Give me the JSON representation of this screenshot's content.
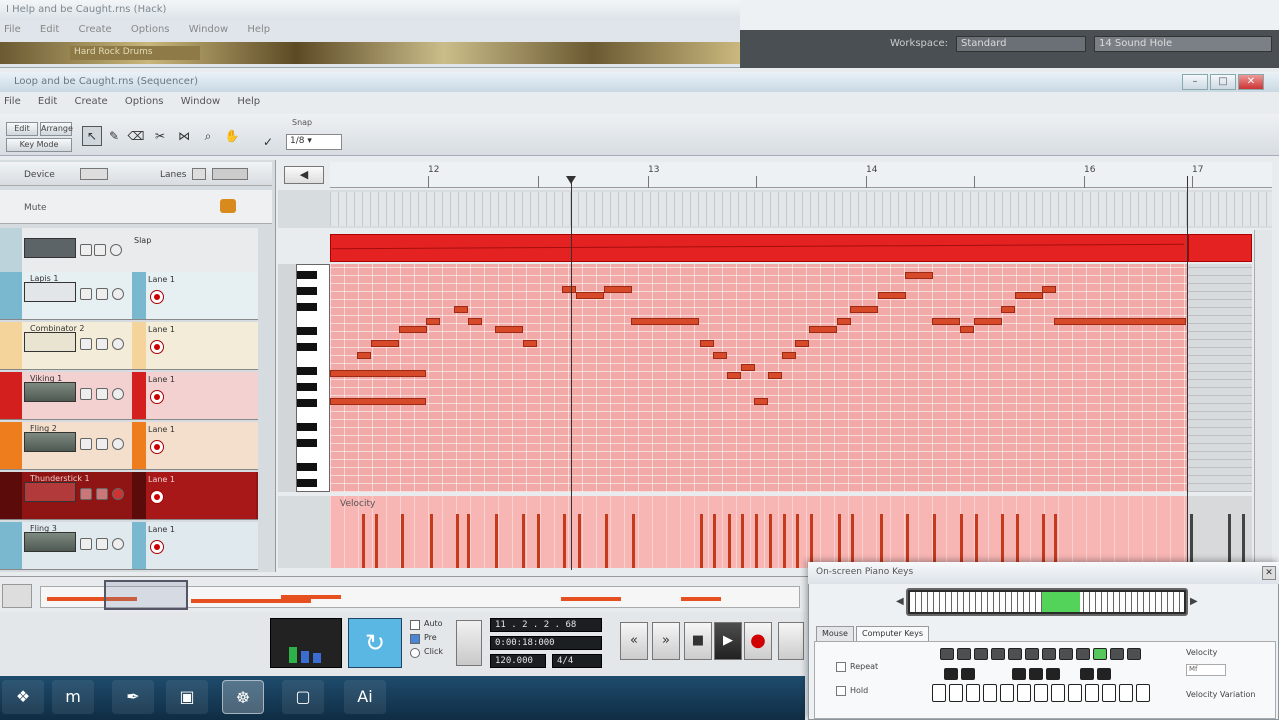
{
  "background_window": {
    "title": "I Help and be Caught.rns (Hack)",
    "menu": [
      "File",
      "Edit",
      "Create",
      "Options",
      "Window",
      "Help"
    ],
    "strip_label": "Hard Rock Drums",
    "workspace_label": "Workspace:",
    "workspace_value": "Standard",
    "workspace_right": "14 Sound Hole"
  },
  "main_window": {
    "title": "Loop and be Caught.rns (Sequencer)",
    "menu": [
      "File",
      "Edit",
      "Create",
      "Options",
      "Window",
      "Help"
    ]
  },
  "toolbar": {
    "mode_edit": "Edit",
    "mode_arrange": "Arrange",
    "mode_key": "Key Mode",
    "snap_label": "Snap",
    "snap_value": "1/8"
  },
  "tracklist": {
    "device_label": "Device",
    "lanes_label": "Lanes",
    "mute_label": "Mute",
    "tracks": [
      {
        "name": "Slap",
        "lane": ""
      },
      {
        "name": "Lapis 1",
        "lane": "Lane 1"
      },
      {
        "name": "Combinator 2",
        "lane": "Lane 1"
      },
      {
        "name": "Viking 1",
        "lane": "Lane 1"
      },
      {
        "name": "Fling 2",
        "lane": "Lane 1"
      },
      {
        "name": "Thunderstick 1",
        "lane": "Lane 1"
      },
      {
        "name": "Fling 3",
        "lane": "Lane 1"
      }
    ]
  },
  "ruler": {
    "bars": [
      "12",
      "",
      "13",
      "",
      "14",
      "",
      "16",
      "17"
    ]
  },
  "editor": {
    "velocity_label": "Velocity"
  },
  "notes": [
    [
      330,
      96,
      370
    ],
    [
      330,
      96,
      398
    ],
    [
      357,
      14,
      352
    ],
    [
      371,
      28,
      340
    ],
    [
      399,
      28,
      326
    ],
    [
      426,
      14,
      318
    ],
    [
      454,
      14,
      306
    ],
    [
      468,
      14,
      318
    ],
    [
      495,
      28,
      326
    ],
    [
      523,
      14,
      340
    ],
    [
      562,
      14,
      286
    ],
    [
      576,
      28,
      292
    ],
    [
      604,
      28,
      286
    ],
    [
      631,
      68,
      318
    ],
    [
      700,
      14,
      340
    ],
    [
      713,
      14,
      352
    ],
    [
      727,
      14,
      372
    ],
    [
      741,
      14,
      364
    ],
    [
      754,
      14,
      398
    ],
    [
      768,
      14,
      372
    ],
    [
      782,
      14,
      352
    ],
    [
      795,
      14,
      340
    ],
    [
      809,
      28,
      326
    ],
    [
      837,
      14,
      318
    ],
    [
      850,
      28,
      306
    ],
    [
      878,
      28,
      292
    ],
    [
      905,
      28,
      272
    ],
    [
      932,
      28,
      318
    ],
    [
      960,
      14,
      326
    ],
    [
      974,
      28,
      318
    ],
    [
      1001,
      14,
      306
    ],
    [
      1015,
      28,
      292
    ],
    [
      1042,
      14,
      286
    ],
    [
      1054,
      132,
      318
    ]
  ],
  "velocities": [
    362,
    375,
    401,
    430,
    456,
    467,
    495,
    522,
    537,
    563,
    578,
    605,
    632,
    700,
    713,
    728,
    741,
    755,
    769,
    783,
    796,
    810,
    838,
    851,
    880,
    906,
    933,
    960,
    975,
    1001,
    1016,
    1042,
    1054
  ],
  "transport": {
    "lcd_position": "11 . 2 . 2 . 68",
    "lcd_time": "0:00:18:000",
    "lcd_tempo": "120.000",
    "lcd_signature": "4/4",
    "auto_label": "Auto",
    "pre_label": "Pre",
    "click_label": "Click"
  },
  "taskbar": {
    "items": [
      "start",
      "maxthon",
      "pen",
      "photos",
      "reason",
      "folder",
      "illustrator"
    ]
  },
  "osk": {
    "title": "On-screen Piano Keys",
    "tab_mouse": "Mouse",
    "tab_keys": "Computer Keys",
    "repeat_label": "Repeat",
    "hold_label": "Hold",
    "velocity_label": "Velocity",
    "velocity_value": "Mf",
    "velocity_variation_label": "Velocity Variation"
  }
}
